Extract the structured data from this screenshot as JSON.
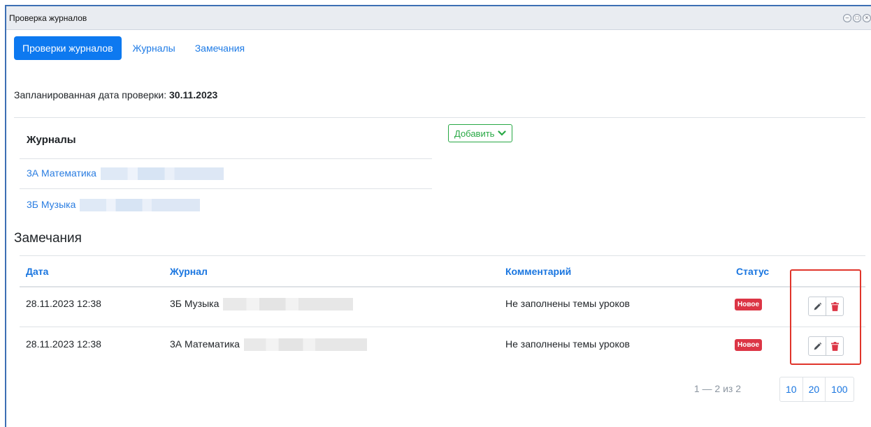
{
  "window": {
    "title": "Проверка журналов"
  },
  "tabs": [
    {
      "label": "Проверки журналов",
      "active": true
    },
    {
      "label": "Журналы",
      "active": false
    },
    {
      "label": "Замечания",
      "active": false
    }
  ],
  "planned": {
    "label": "Запланированная дата проверки:",
    "date": "30.11.2023"
  },
  "journals": {
    "header": "Журналы",
    "items": [
      "3А Математика",
      "3Б Музыка"
    ],
    "add_button": "Добавить"
  },
  "remarks": {
    "title": "Замечания",
    "columns": [
      "Дата",
      "Журнал",
      "Комментарий",
      "Статус"
    ],
    "rows": [
      {
        "date": "28.11.2023 12:38",
        "journal": "3Б Музыка",
        "comment": "Не заполнены темы уроков",
        "status": "Новое"
      },
      {
        "date": "28.11.2023 12:38",
        "journal": "3А Математика",
        "comment": "Не заполнены темы уроков",
        "status": "Новое"
      }
    ]
  },
  "pagination": {
    "info": "1 — 2 из 2",
    "sizes": [
      "10",
      "20",
      "100"
    ]
  },
  "colors": {
    "primary": "#0d79f0",
    "link": "#1a76e0",
    "success": "#27a844",
    "danger": "#dc3545",
    "highlight": "#e0352b"
  },
  "icons": [
    "pencil-icon",
    "trash-icon",
    "chevron-down-icon"
  ]
}
